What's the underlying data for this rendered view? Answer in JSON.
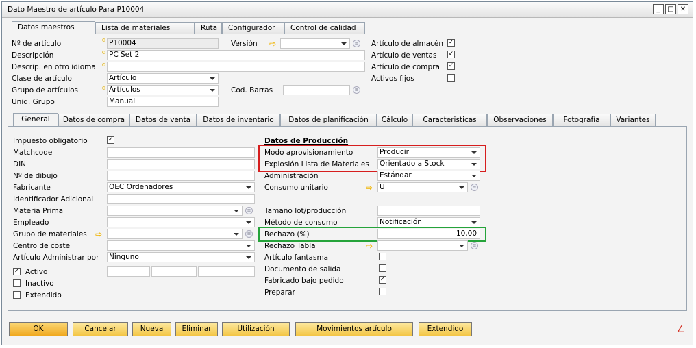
{
  "window": {
    "title": "Dato Maestro de artículo Para P10004"
  },
  "top_tabs": [
    "Datos maestros",
    "Lista de materiales",
    "Ruta",
    "Configurador",
    "Control de calidad"
  ],
  "header": {
    "item_no_label": "Nº de artículo",
    "item_no_value": "P10004",
    "description_label": "Descripción",
    "description_value": "PC Set 2",
    "foreign_desc_label": "Descrip. en otro idioma",
    "foreign_desc_value": "",
    "item_class_label": "Clase de artículo",
    "item_class_value": "Artículo",
    "item_group_label": "Grupo de artículos",
    "item_group_value": "Artículos",
    "uom_group_label": "Unid. Grupo",
    "uom_group_value": "Manual",
    "version_label": "Versión",
    "version_value": "",
    "barcode_label": "Cod. Barras",
    "barcode_value": "",
    "inventory_item_label": "Artículo de almacén",
    "sales_item_label": "Artículo de ventas",
    "purchase_item_label": "Artículo de compra",
    "fixed_assets_label": "Activos fijos"
  },
  "sub_tabs": [
    "General",
    "Datos de compra",
    "Datos de venta",
    "Datos de inventario",
    "Datos de planificación",
    "Cálculo",
    "Caracteristicas",
    "Observaciones",
    "Fotografía",
    "Variantes"
  ],
  "general": {
    "tax_label": "Impuesto obligatorio",
    "matchcode_label": "Matchcode",
    "din_label": "DIN",
    "drawing_label": "Nº de dibujo",
    "manufacturer_label": "Fabricante",
    "manufacturer_value": "OEC Ordenadores",
    "additional_id_label": "Identificador Adicional",
    "raw_material_label": "Materia Prima",
    "employee_label": "Empleado",
    "material_group_label": "Grupo de materiales",
    "cost_center_label": "Centro de coste",
    "manage_by_label": "Artículo Administrar por",
    "manage_by_value": "Ninguno",
    "active_label": "Activo",
    "inactive_label": "Inactivo",
    "extended_label": "Extendido"
  },
  "production": {
    "section_title": "Datos de Producción",
    "procurement_label": "Modo aprovisionamiento",
    "procurement_value": "Producir",
    "bom_explosion_label": "Explosión Lista de Materiales",
    "bom_explosion_value": "Orientado a Stock",
    "administration_label": "Administración",
    "administration_value": "Estándar",
    "unit_consumption_label": "Consumo unitario",
    "unit_consumption_value": "U",
    "lot_size_label": "Tamaño lot/producción",
    "lot_size_value": "",
    "consumption_method_label": "Método de consumo",
    "consumption_method_value": "Notificación",
    "scrap_label": "Rechazo (%)",
    "scrap_value": "10,00",
    "scrap_table_label": "Rechazo Tabla",
    "scrap_table_value": "",
    "phantom_label": "Artículo fantasma",
    "issue_doc_label": "Documento de salida",
    "mto_label": "Fabricado bajo pedido",
    "prepare_label": "Preparar"
  },
  "checks": {
    "inventory_item": true,
    "sales_item": true,
    "purchase_item": true,
    "fixed_assets": false,
    "tax": true,
    "active": true,
    "inactive": false,
    "extended": false,
    "phantom": false,
    "issue_doc": false,
    "mto": true,
    "prepare": false
  },
  "buttons": {
    "ok": "OK",
    "cancel": "Cancelar",
    "new": "Nueva",
    "delete": "Eliminar",
    "usage": "Utilización",
    "movements": "Movimientos artículo",
    "extended": "Extendido"
  },
  "colors": {
    "highlight_red": "#d61e1e",
    "highlight_green": "#25a33a",
    "button_accent": "#f3c545"
  }
}
